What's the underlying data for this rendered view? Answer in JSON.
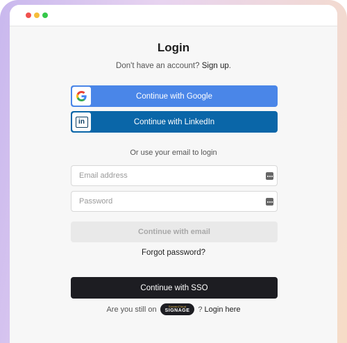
{
  "window": {
    "controls": [
      "close",
      "minimize",
      "maximize"
    ],
    "colors": {
      "close": "#f0514e",
      "minimize": "#f6bd3a",
      "maximize": "#35c84a"
    }
  },
  "login": {
    "title": "Login",
    "no_account_text": "Don't have an account?",
    "sign_up_link": "Sign up",
    "sign_up_period": ".",
    "google_button": "Continue with Google",
    "linkedin_button": "Continue with LinkedIn",
    "or_text": "Or use your email to login",
    "email_placeholder": "Email address",
    "password_placeholder": "Password",
    "email_button": "Continue with email",
    "forgot_password": "Forgot password?",
    "sso_button": "Continue with SSO",
    "still_on_text": "Are you still on",
    "badge_small": "ScreenCloud",
    "badge_big": "SIGNAGE",
    "question_mark": "?",
    "login_here": "Login here"
  },
  "icons": {
    "google": "google-logo-icon",
    "linkedin": "linkedin-logo-icon",
    "password_manager": "password-manager-icon"
  },
  "colors": {
    "google_blue": "#4a86e8",
    "linkedin_blue": "#0a66a8",
    "sso_dark": "#1d1d22"
  }
}
